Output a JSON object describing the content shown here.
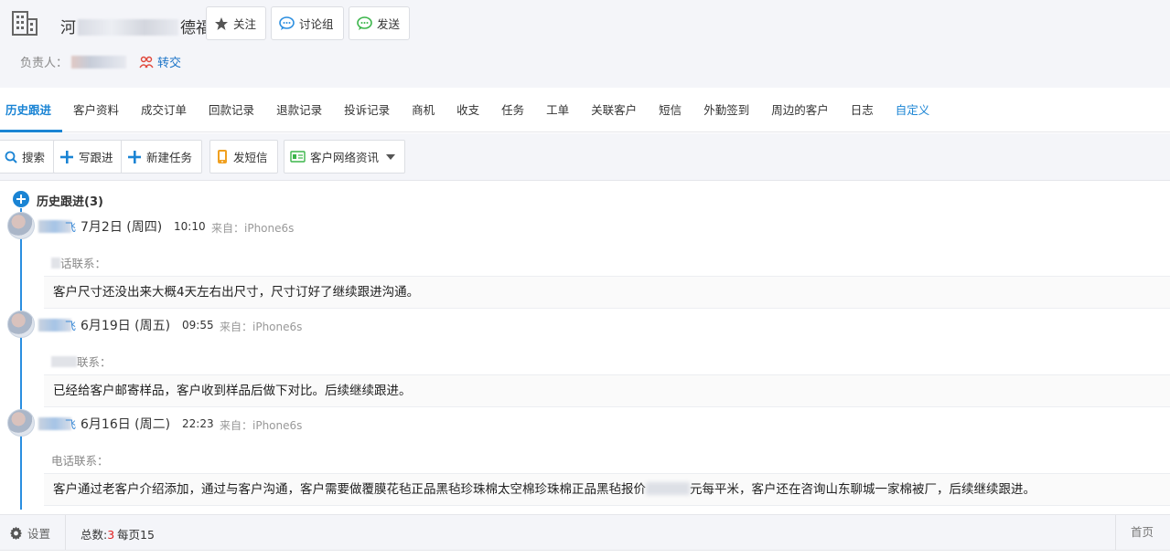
{
  "header": {
    "customer_name_start": "河",
    "customer_name_end": "德福",
    "buttons": {
      "follow": "关注",
      "discussion": "讨论组",
      "send": "发送"
    },
    "owner_label": "负责人：",
    "transfer_label": "转交"
  },
  "tabs": [
    {
      "label": "历史跟进",
      "active": true
    },
    {
      "label": "客户资料"
    },
    {
      "label": "成交订单"
    },
    {
      "label": "回款记录"
    },
    {
      "label": "退款记录"
    },
    {
      "label": "投诉记录"
    },
    {
      "label": "商机"
    },
    {
      "label": "收支"
    },
    {
      "label": "任务"
    },
    {
      "label": "工单"
    },
    {
      "label": "关联客户"
    },
    {
      "label": "短信"
    },
    {
      "label": "外勤签到"
    },
    {
      "label": "周边的客户"
    },
    {
      "label": "日志"
    },
    {
      "label": "自定义"
    }
  ],
  "toolbar": {
    "search": "搜索",
    "write_followup": "写跟进",
    "new_task": "新建任务",
    "send_sms": "发短信",
    "network_info": "客户网络资讯"
  },
  "timeline": {
    "title": "历史跟进(3)",
    "entries": [
      {
        "user_suffix": "飞",
        "date": "7月2日 (周四)",
        "time": "10:10",
        "source": "来自：iPhone6s",
        "contact_label": "话联系：",
        "content": "客户尺寸还没出来大概4天左右出尺寸，尺寸订好了继续跟进沟通。"
      },
      {
        "user_suffix": "飞",
        "date": "6月19日 (周五)",
        "time": "09:55",
        "source": "来自：iPhone6s",
        "contact_label": "联系：",
        "content": "已经给客户邮寄样品，客户收到样品后做下对比。后续继续跟进。"
      },
      {
        "user_suffix": "飞",
        "date": "6月16日 (周二)",
        "time": "22:23",
        "source": "来自：iPhone6s",
        "contact_label": "电话联系：",
        "content_start": "客户通过老客户介绍添加，通过与客户沟通，客户需要做覆膜花毡正品黑毡珍珠棉太空棉珍珠棉正品黑毡报价",
        "content_end": "元每平米，客户还在咨询山东聊城一家棉被厂，后续继续跟进。"
      }
    ]
  },
  "footer": {
    "settings": "设置",
    "total_label": "总数:",
    "total_value": "3",
    "per_page": "每页15",
    "first_page": "首页"
  },
  "colors": {
    "accent": "#1a84d4",
    "header_bg": "#f4f5f9",
    "total_red": "#e02020"
  }
}
